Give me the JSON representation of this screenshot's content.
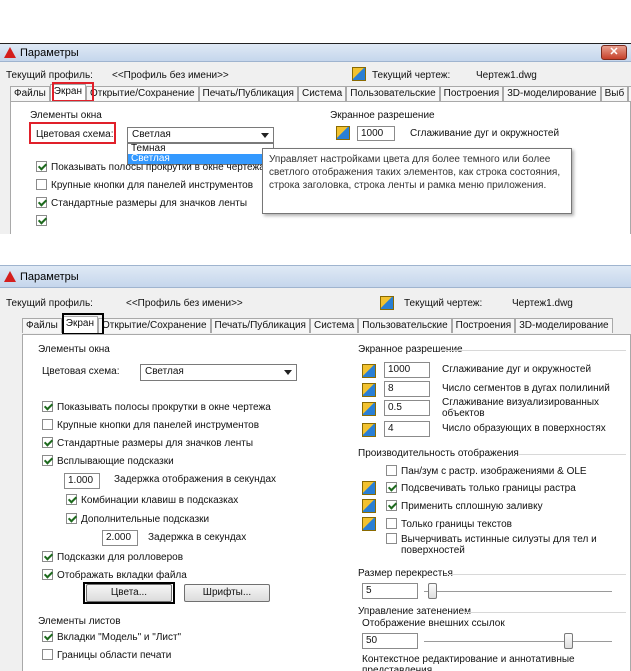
{
  "dialog1": {
    "title": "Параметры",
    "close": "✕",
    "profile_label": "Текущий профиль:",
    "profile_value": "<<Профиль без имени>>",
    "drawing_label": "Текущий чертеж:",
    "drawing_value": "Чертеж1.dwg",
    "tabs": [
      "Файлы",
      "Экран",
      "Открытие/Сохранение",
      "Печать/Публикация",
      "Система",
      "Пользовательские",
      "Построения",
      "3D-моделирование",
      "Выб"
    ],
    "group_window": "Элементы окна",
    "color_scheme_label": "Цветовая схема:",
    "color_scheme_value": "Светлая",
    "dropdown_options": [
      "Темная",
      "Светлая"
    ],
    "tooltip": "Управляет настройками цвета для более темного или более светлого отображения таких элементов, как строка состояния, строка заголовка, строка ленты и рамка меню приложения.",
    "checks": [
      "Показывать полосы прокрутки в окне чертежа",
      "Крупные кнопки для панелей инструментов",
      "Стандартные размеры для значков ленты"
    ],
    "group_res": "Экранное разрешение",
    "res_value": "1000",
    "res_label": "Сглаживание дуг и окружностей"
  },
  "dialog2": {
    "title": "Параметры",
    "profile_label": "Текущий профиль:",
    "profile_value": "<<Профиль без имени>>",
    "drawing_label": "Текущий чертеж:",
    "drawing_value": "Чертеж1.dwg",
    "tabs": [
      "Файлы",
      "Экран",
      "Открытие/Сохранение",
      "Печать/Публикация",
      "Система",
      "Пользовательские",
      "Построения",
      "3D-моделирование"
    ],
    "group_window": "Элементы окна",
    "color_scheme_label": "Цветовая схема:",
    "color_scheme_value": "Светлая",
    "checks": {
      "scroll": "Показывать полосы прокрутки в окне чертежа",
      "large_btns": "Крупные кнопки для панелей инструментов",
      "ribbon_icons": "Стандартные размеры для значков ленты",
      "tooltips": "Всплывающие подсказки",
      "tooltip_delay_value": "1.000",
      "tooltip_delay_label": "Задержка отображения в секундах",
      "key_combos": "Комбинации клавиш в подсказках",
      "extra_tooltips": "Дополнительные подсказки",
      "extra_delay_value": "2.000",
      "extra_delay_label": "Задержка в секундах",
      "rollover": "Подсказки для ролловеров",
      "file_tabs": "Отображать вкладки файла"
    },
    "colors_btn": "Цвета...",
    "fonts_btn": "Шрифты...",
    "group_layout": "Элементы листов",
    "layout_checks": [
      "Вкладки \"Модель\" и \"Лист\"",
      "Границы области печати"
    ],
    "group_res": "Экранное разрешение",
    "res": [
      {
        "value": "1000",
        "label": "Сглаживание дуг и окружностей"
      },
      {
        "value": "8",
        "label": "Число сегментов в дугах полилиний"
      },
      {
        "value": "0.5",
        "label": "Сглаживание визуализированных объектов"
      },
      {
        "value": "4",
        "label": "Число образующих в поверхностях"
      }
    ],
    "group_perf": "Производительность отображения",
    "perf": [
      {
        "label": "Пан/зум с растр. изображениями & OLE",
        "on": false
      },
      {
        "label": "Подсвечивать только границы растра",
        "on": true
      },
      {
        "label": "Применить сплошную заливку",
        "on": true
      },
      {
        "label": "Только границы текстов",
        "on": false
      },
      {
        "label": "Вычерчивать истинные силуэты для тел и поверхностей",
        "on": false
      }
    ],
    "group_crosshair": "Размер перекрестья",
    "crosshair_value": "5",
    "group_fade": "Управление затенением",
    "xref_label": "Отображение внешних ссылок",
    "xref_value": "50",
    "ctx_label": "Контекстное редактирование и аннотативные представления"
  }
}
